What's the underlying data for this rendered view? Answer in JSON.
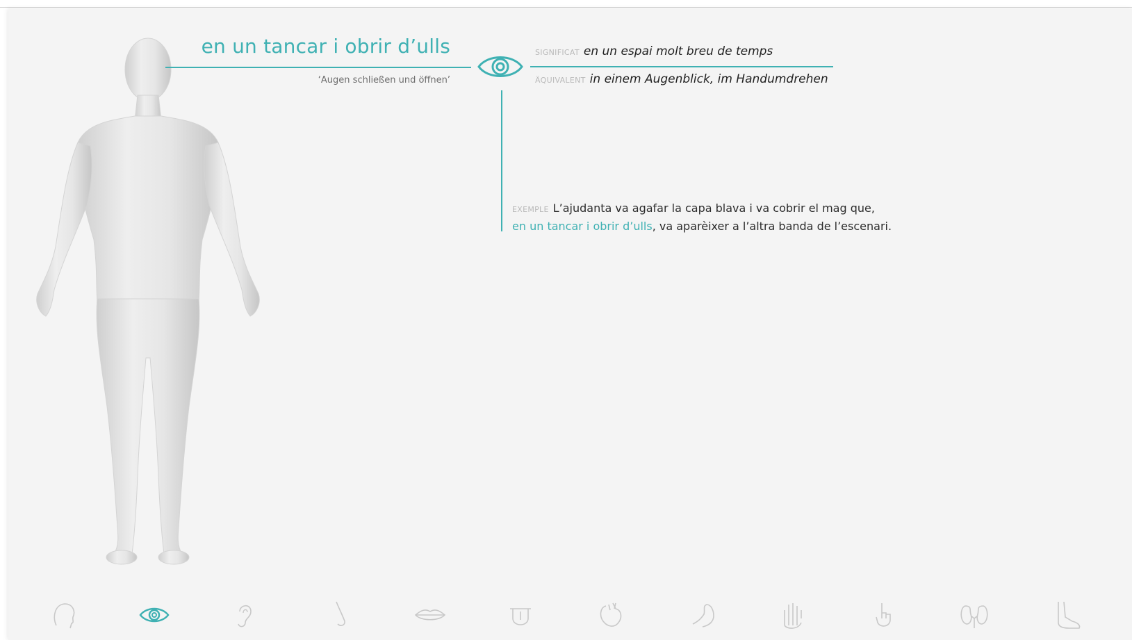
{
  "phrase": {
    "title": "en un tancar i obrir d’ulls",
    "translation": "‘Augen schließen und öffnen’"
  },
  "definition": {
    "significat_label": "SIGNIFICAT",
    "significat_text": "en un espai molt breu de temps",
    "aquivalent_label": "ÄQUIVALENT",
    "aquivalent_text": "in einem Augenblick, im Handumdrehen"
  },
  "example": {
    "label": "EXEMPLE",
    "line1": "L’ajudanta va agafar la capa blava i va cobrir el mag que,",
    "highlight": "en un tancar i obrir d’ulls",
    "rest": ", va aparèixer a l’altra banda de l’escenari."
  },
  "colors": {
    "accent": "#3fb1b3",
    "icon_inactive": "#c8c8c8",
    "panel_bg": "#f4f4f4"
  },
  "toolbar": {
    "active": "eye-icon",
    "icons": [
      "head-icon",
      "eye-icon",
      "ear-icon",
      "nose-icon",
      "lips-icon",
      "tongue-icon",
      "heart-icon",
      "arm-muscle-icon",
      "hand-icon",
      "finger-icon",
      "kidneys-icon",
      "foot-icon"
    ]
  }
}
